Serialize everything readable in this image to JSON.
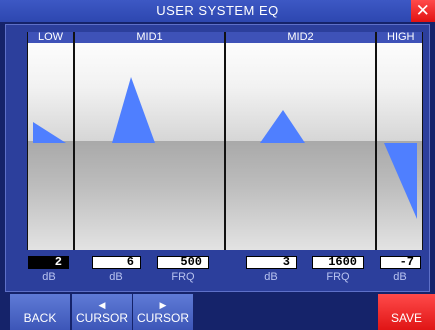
{
  "window": {
    "title": "USER SYSTEM EQ",
    "close_glyph": "✕"
  },
  "bands": {
    "low": {
      "label": "LOW"
    },
    "mid1": {
      "label": "MID1"
    },
    "mid2": {
      "label": "MID2"
    },
    "high": {
      "label": "HIGH"
    }
  },
  "values": {
    "low_gain": {
      "value": "2",
      "unit": "dB"
    },
    "mid1_gain": {
      "value": "6",
      "unit": "dB"
    },
    "mid1_freq": {
      "value": "500",
      "unit": "FRQ"
    },
    "mid2_gain": {
      "value": "3",
      "unit": "dB"
    },
    "mid2_freq": {
      "value": "1600",
      "unit": "FRQ"
    },
    "high_gain": {
      "value": "-7",
      "unit": "dB"
    }
  },
  "buttons": {
    "back": "BACK",
    "cursor_left": "CURSOR",
    "cursor_right": "CURSOR",
    "save": "SAVE"
  },
  "icons": {
    "close": "close-icon",
    "left_arrow": "arrow-left-icon",
    "right_arrow": "arrow-right-icon"
  },
  "colors": {
    "accent": "#3e52b8",
    "curve_fill": "#4f7fff",
    "save_button": "#e82020"
  }
}
